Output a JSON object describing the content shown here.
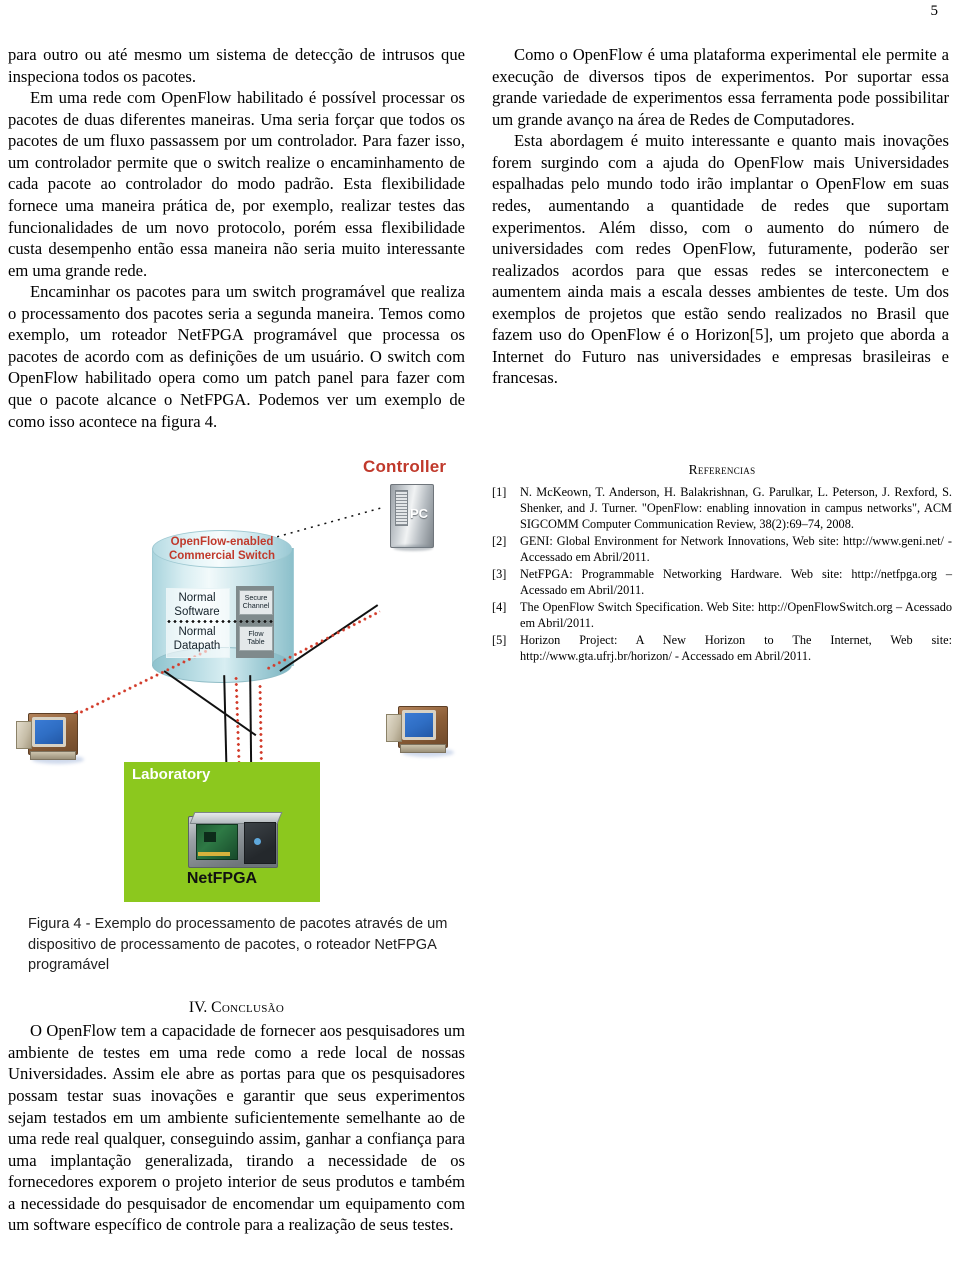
{
  "page": {
    "number": "5"
  },
  "left_column": {
    "paragraphs": [
      "para outro ou até mesmo um sistema de detecção de intrusos que inspeciona todos os pacotes.",
      "Em uma rede com OpenFlow habilitado é possível processar os pacotes de duas diferentes maneiras. Uma seria forçar que todos os pacotes de um fluxo passassem por um controlador. Para fazer isso, um controlador permite que o switch realize o encaminhamento de cada pacote ao controlador do modo padrão. Esta flexibilidade fornece uma maneira prática de, por exemplo, realizar testes das funcionalidades de um novo protocolo, porém essa flexibilidade custa desempenho então essa maneira não seria muito interessante em uma grande rede.",
      "Encaminhar os pacotes para um switch programável que realiza o processamento dos pacotes seria a segunda maneira. Temos como exemplo, um roteador NetFPGA programável que processa os pacotes de acordo com as definições de um usuário. O switch com OpenFlow habilitado opera como um patch panel para fazer com que o pacote alcance o NetFPGA. Podemos ver um exemplo de como isso acontece na figura 4."
    ]
  },
  "right_column": {
    "paragraphs": [
      "Como o OpenFlow é uma plataforma experimental ele permite a execução de diversos tipos de experimentos. Por suportar essa grande variedade de experimentos essa ferramenta pode possibilitar um grande avanço na área de Redes de Computadores.",
      "Esta abordagem é muito interessante e quanto mais inovações forem surgindo com a ajuda do OpenFlow mais Universidades espalhadas pelo mundo todo irão implantar o OpenFlow em suas redes, aumentando a quantidade de redes que suportam experimentos. Além disso, com o aumento do número de universidades com redes OpenFlow, futuramente, poderão ser realizados acordos para que essas redes se interconectem e aumentem ainda mais a escala desses ambientes de teste. Um dos exemplos de projetos que estão sendo realizados no Brasil que fazem uso do OpenFlow é o Horizon[5], um projeto que aborda a Internet do Futuro nas universidades e empresas brasileiras e francesas."
    ]
  },
  "figure": {
    "controller_label": "Controller",
    "controller_pc_label": "PC",
    "switch_title_line1": "OpenFlow-enabled",
    "switch_title_line2": "Commercial Switch",
    "switch_cells": {
      "normal_software": "Normal\nSoftware",
      "normal_datapath": "Normal\nDatapath",
      "secure_channel": "Secure\nChannel",
      "flow_table": "Flow\nTable"
    },
    "lab_label": "Laboratory",
    "netfpga_label": "NetFPGA",
    "caption": "Figura 4 - Exemplo do processamento de pacotes através de um dispositivo de processamento de pacotes, o roteador NetFPGA programável",
    "colors": {
      "lab_green": "#8cc81e",
      "label_red": "#c0392b",
      "packet_path_red": "#d23b2a",
      "switch_cyan": "#b6dbe3"
    }
  },
  "references": {
    "title": "Referencias",
    "items": [
      {
        "num": "[1]",
        "text": "N. McKeown, T. Anderson, H. Balakrishnan, G. Parulkar, L. Peterson, J. Rexford, S. Shenker, and J. Turner. \"OpenFlow: enabling innovation in campus networks\", ACM SIGCOMM Computer Communication Review, 38(2):69–74, 2008."
      },
      {
        "num": "[2]",
        "text": "GENI: Global Environment for Network Innovations, Web site: http://www.geni.net/ - Accessado em Abril/2011."
      },
      {
        "num": "[3]",
        "text": "NetFPGA: Programmable Networking Hardware. Web site: http://netfpga.org – Acessado em Abril/2011."
      },
      {
        "num": "[4]",
        "text": "The OpenFlow Switch Specification. Web Site: http://OpenFlowSwitch.org – Acessado em Abril/2011."
      },
      {
        "num": "[5]",
        "text": "Horizon Project: A New Horizon to The Internet, Web site: http://www.gta.ufrj.br/horizon/ - Accessado em Abril/2011."
      }
    ]
  },
  "conclusion": {
    "numeral": "IV.",
    "heading": "Conclusão",
    "paragraph": "O OpenFlow tem a capacidade de fornecer aos pesquisadores um ambiente de testes em uma rede como a rede local de nossas Universidades. Assim ele abre as portas para que os pesquisadores possam testar suas inovações e garantir que seus experimentos sejam testados em um ambiente suficientemente semelhante ao de uma rede real qualquer, conseguindo assim, ganhar a confiança para uma implantação generalizada, tirando a necessidade de os fornecedores exporem o projeto interior de seus produtos e também a necessidade do pesquisador de encomendar um equipamento com um software específico de controle para a realização de seus testes."
  }
}
